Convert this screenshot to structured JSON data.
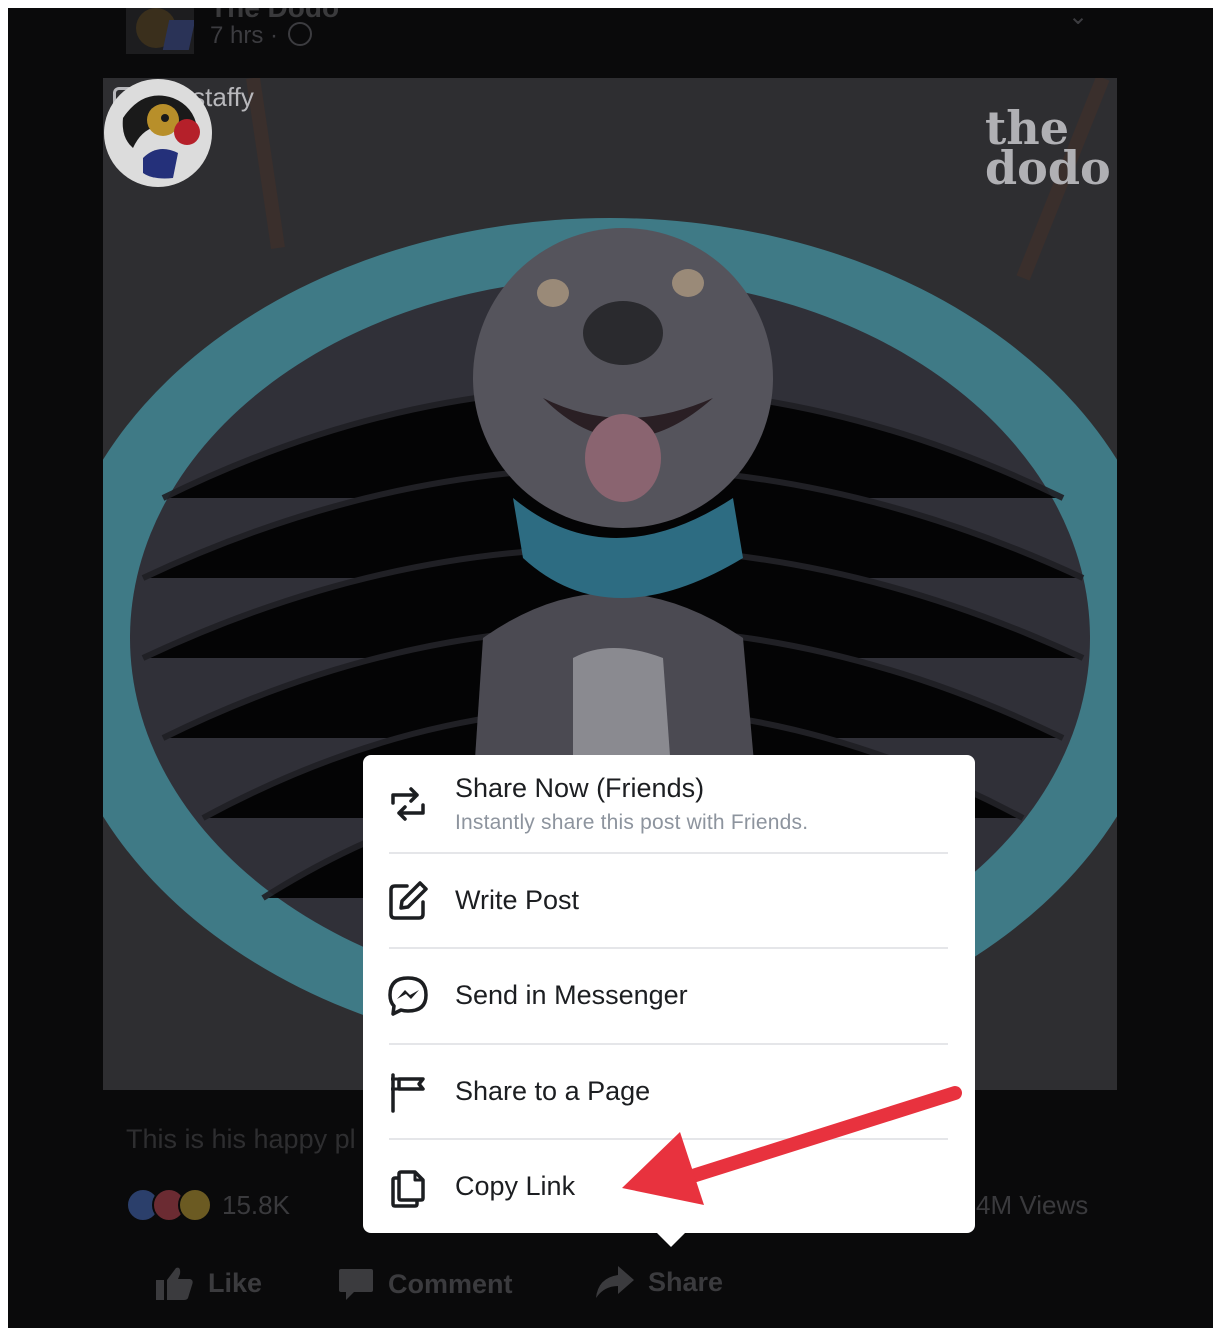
{
  "post": {
    "page_name": "The Dodo",
    "time": "7 hrs ·",
    "caption": "This is his happy pl",
    "reaction_count": "15.8K",
    "views": "4M Views"
  },
  "media": {
    "instagram_handle": "bluestaffy",
    "watermark_line1": "the",
    "watermark_line2": "dodo"
  },
  "actions": {
    "like": "Like",
    "comment": "Comment",
    "share": "Share"
  },
  "share_menu": {
    "share_now_title": "Share Now (Friends)",
    "share_now_subtitle": "Instantly share this post with Friends.",
    "write_post": "Write Post",
    "send_messenger": "Send in Messenger",
    "share_page": "Share to a Page",
    "copy_link": "Copy Link"
  },
  "colors": {
    "annotation_arrow": "#e8323e",
    "menu_text": "#1c1e21",
    "menu_subtext": "#8d949e"
  }
}
